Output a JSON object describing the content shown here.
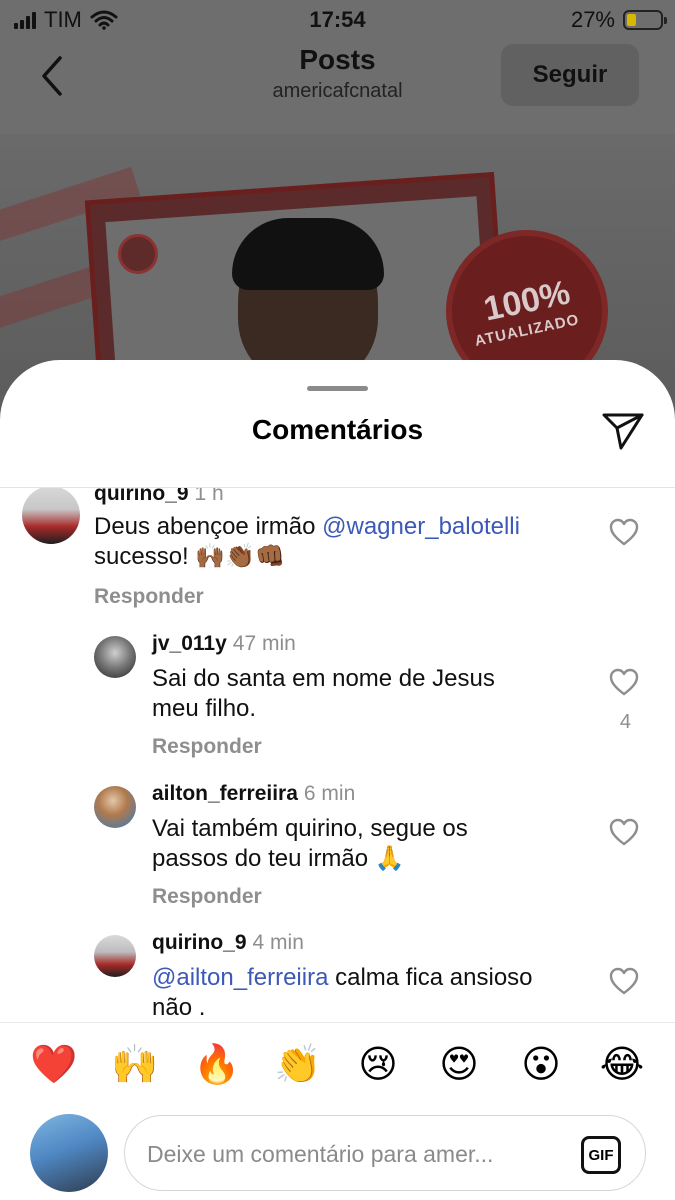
{
  "status_bar": {
    "carrier": "TIM",
    "time": "17:54",
    "battery": "27%",
    "battery_level": 0.27
  },
  "header": {
    "title": "Posts",
    "username": "americafcnatal",
    "follow_label": "Seguir"
  },
  "post": {
    "seal_line1": "100%",
    "seal_line2": "ATUALIZADO"
  },
  "sheet": {
    "title": "Comentários"
  },
  "comments": [
    {
      "user": "quirino_9",
      "time": "1 h",
      "text_line1_pre": "Deus abençoe irmão ",
      "mention": "@wagner_balotelli",
      "text_line2": "sucesso! 🙌🏾👏🏾👊🏾",
      "reply": "Responder"
    },
    {
      "user": "jv_011y",
      "time": "47 min",
      "text_line1": "Sai do santa em nome de Jesus",
      "text_line2": "meu filho.",
      "reply": "Responder",
      "likes": "4"
    },
    {
      "user": "ailton_ferreiira",
      "time": "6 min",
      "text_line1": "Vai também quirino, segue os",
      "text_line2": "passos do teu irmão 🙏",
      "reply": "Responder"
    },
    {
      "user": "quirino_9",
      "time": "4 min",
      "mention": "@ailton_ferreiira",
      "text_line1_post": " calma fica ansioso",
      "text_line2": "não ."
    }
  ],
  "reactions": [
    "❤️",
    "🙌",
    "🔥",
    "👏",
    "😢",
    "😍",
    "😮",
    "😂"
  ],
  "composer": {
    "placeholder": "Deixe um comentário para amer...",
    "gif_label": "GIF"
  },
  "colors": {
    "mention": "#3c59b8",
    "muted": "#8e8e8e"
  }
}
